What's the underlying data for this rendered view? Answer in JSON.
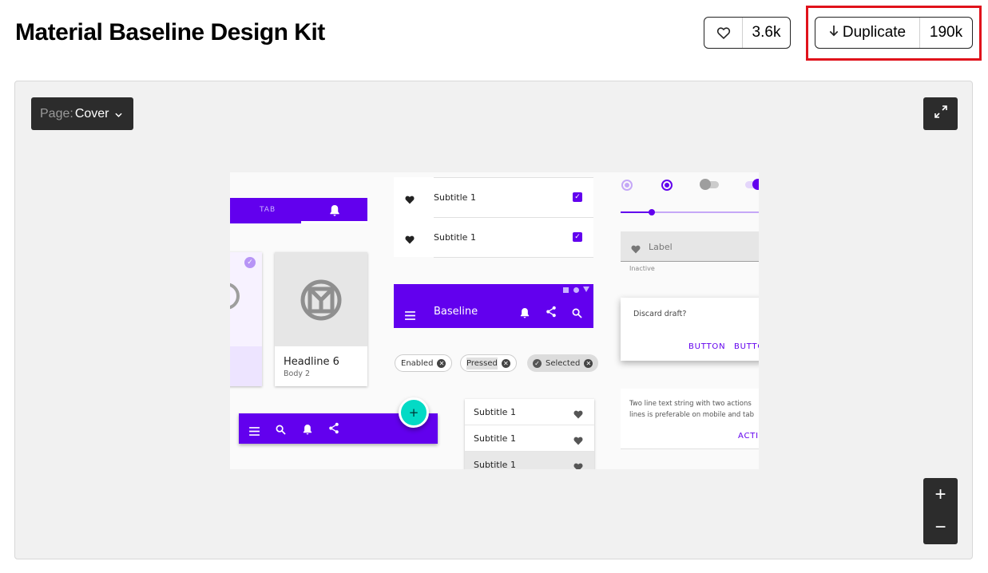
{
  "header": {
    "title": "Material Baseline Design Kit",
    "like_count": "3.6k",
    "duplicate_label": "Duplicate",
    "duplicate_count": "190k"
  },
  "viewer": {
    "page_label": "Page:",
    "page_value": "Cover",
    "zoom_in": "+",
    "zoom_out": "−"
  },
  "preview": {
    "tab_label": "TAB",
    "list_items": [
      "Subtitle 1",
      "Subtitle 1"
    ],
    "app_bar_title": "Baseline",
    "card_headline": "Headline 6",
    "card_body": "Body 2",
    "chips": [
      "Enabled",
      "Pressed",
      "Selected"
    ],
    "menu_items": [
      "Subtitle 1",
      "Subtitle 1",
      "Subtitle 1"
    ],
    "textfield_label": "Label",
    "textfield_helper": "Inactive",
    "dialog_text": "Discard draft?",
    "dialog_button_1": "BUTTON",
    "dialog_button_2": "BUTTO",
    "banner_text_1": "Two line text string with two actions",
    "banner_text_2": "lines is preferable on mobile and tab",
    "banner_action": "ACTIO",
    "fab_label": "+"
  },
  "colors": {
    "accent": "#6200ee",
    "fab": "#03dac5",
    "highlight": "#e0121b"
  },
  "icons": [
    "heart-icon",
    "arrow-down-icon",
    "chevron-down-icon",
    "expand-icon",
    "bell-icon",
    "menu-icon",
    "search-icon",
    "share-icon",
    "checkbox-icon",
    "close-icon",
    "check-icon"
  ]
}
